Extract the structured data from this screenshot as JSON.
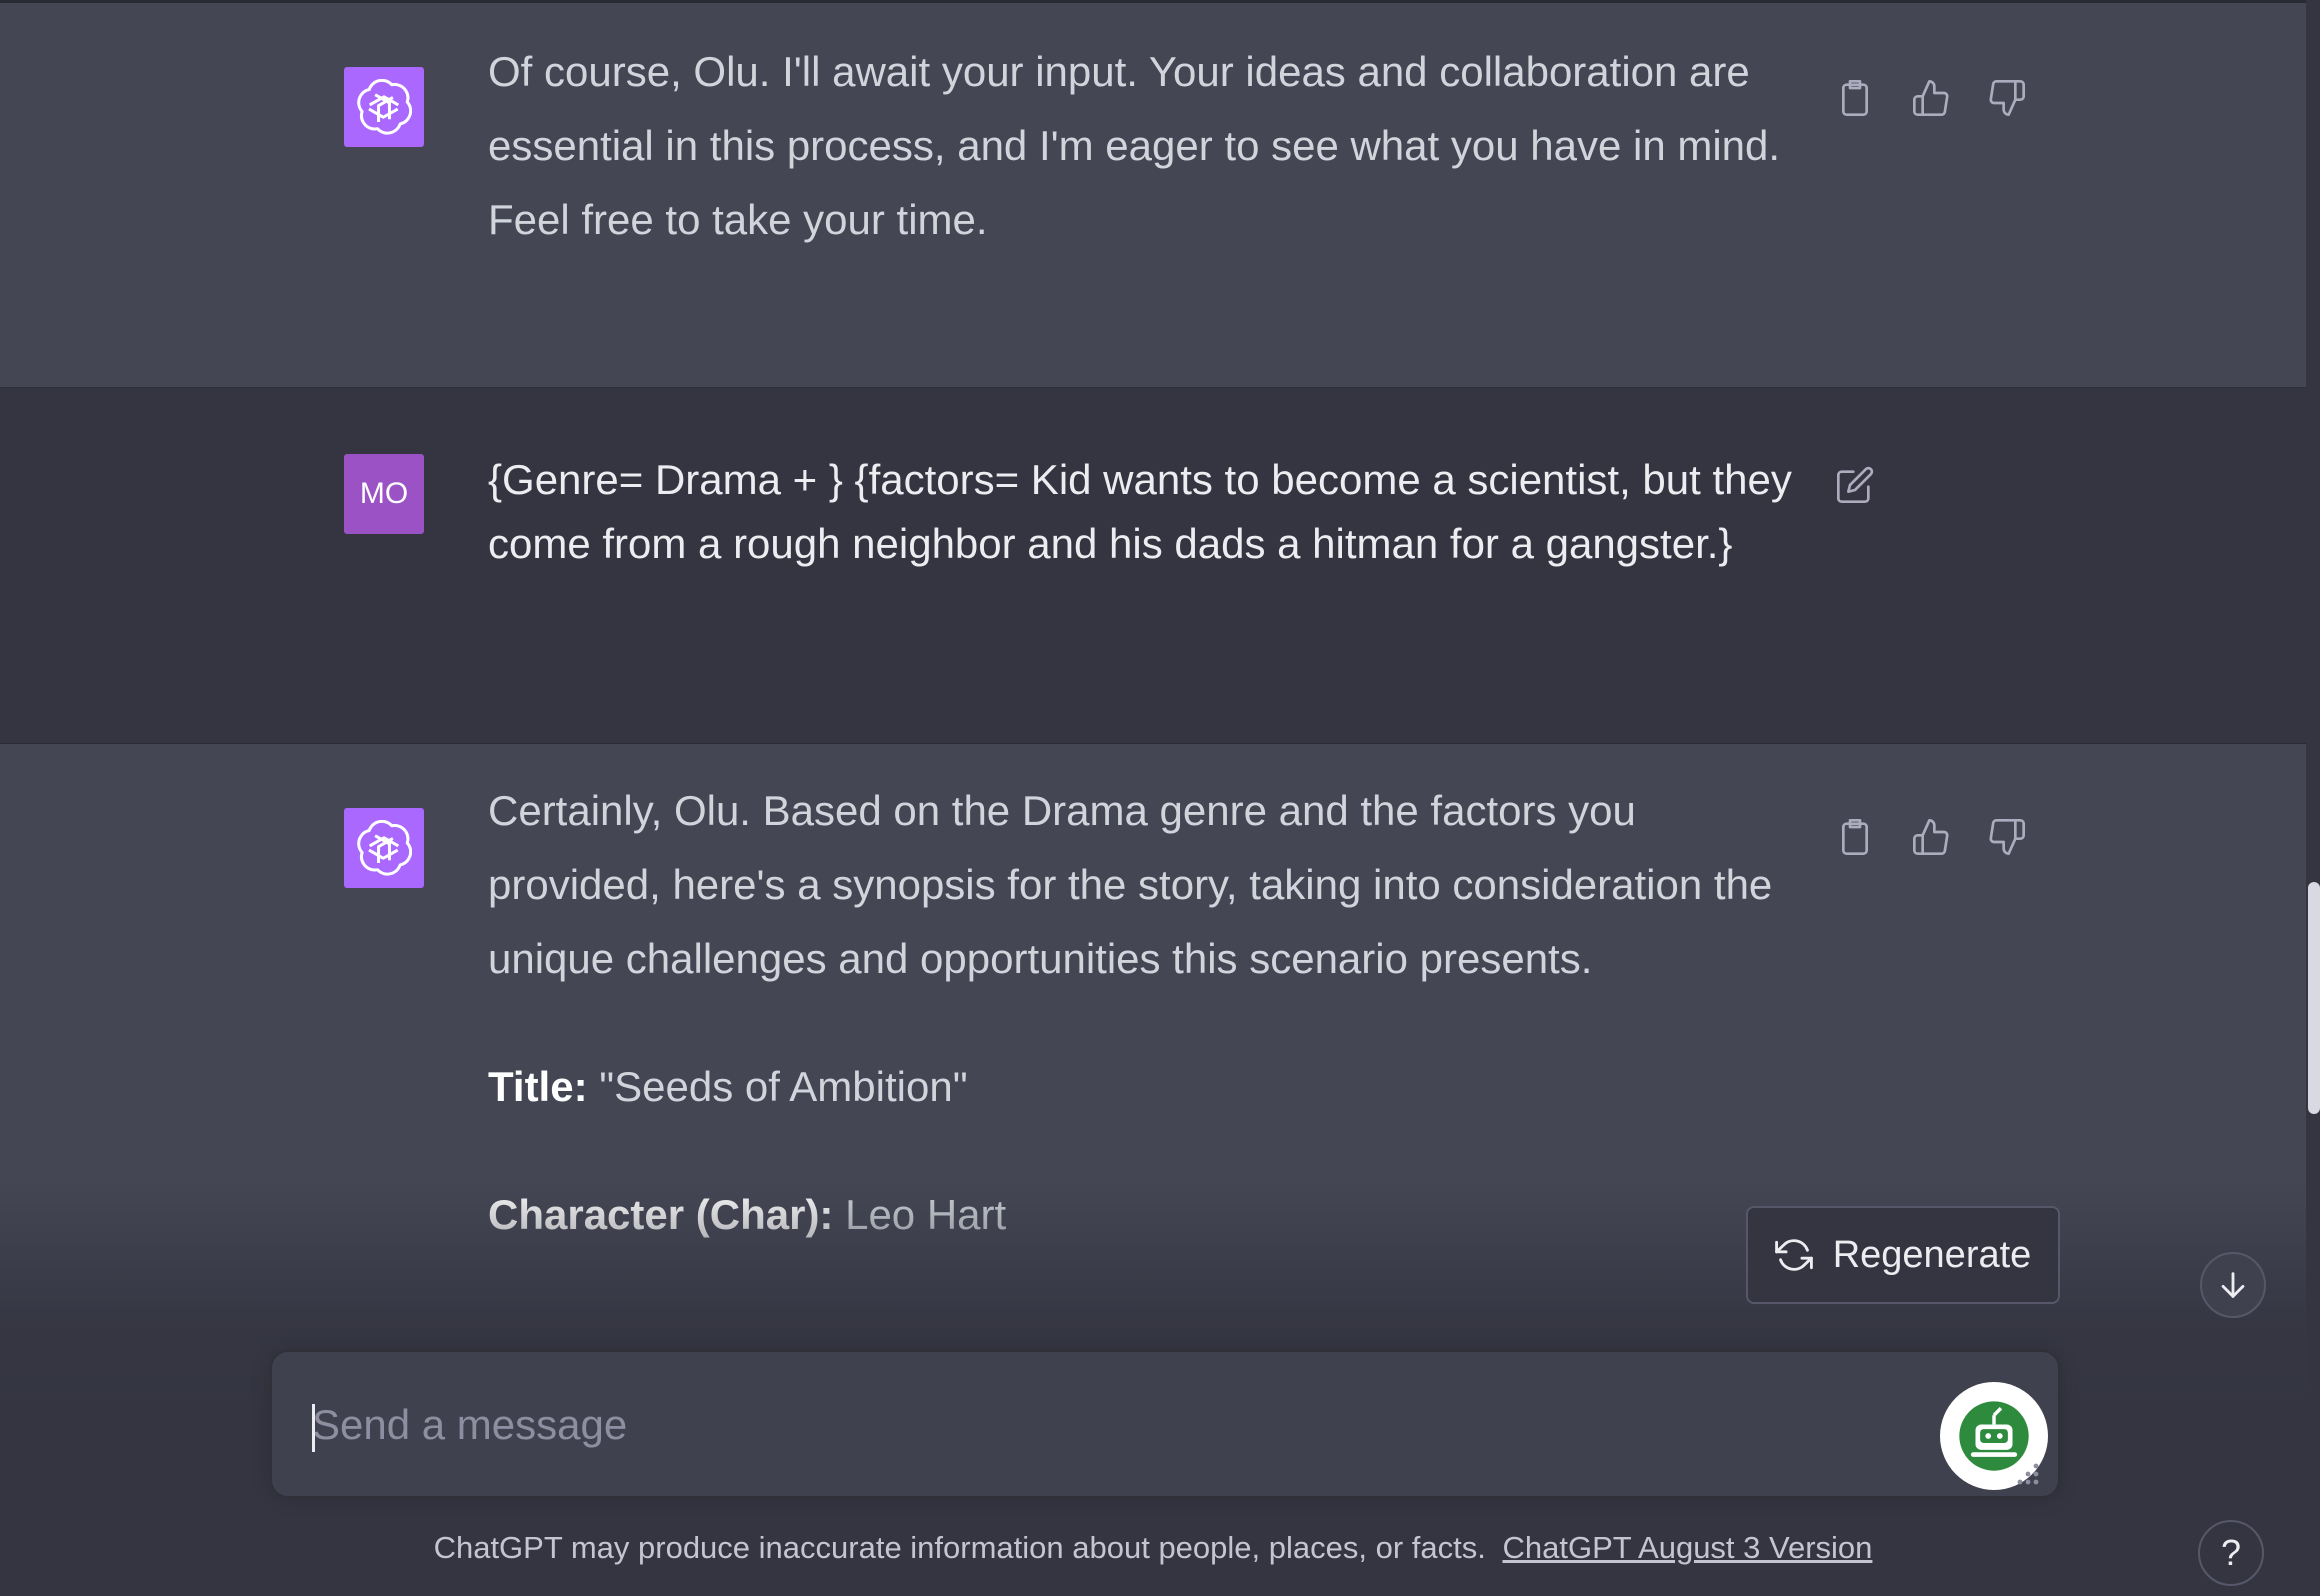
{
  "messages": [
    {
      "role": "assistant",
      "avatar_icon": "openai-logo-icon",
      "text": "Of course, Olu. I'll await your input. Your ideas and collaboration are essential in this process, and I'm eager to see what you have in mind. Feel free to take your time."
    },
    {
      "role": "user",
      "avatar_initials": "MO",
      "text": "{Genre= Drama + } {factors= Kid wants to become a scientist, but they come from a rough neighbor and his dads a hitman for a gangster.}"
    },
    {
      "role": "assistant",
      "avatar_icon": "openai-logo-icon",
      "intro": "Certainly, Olu. Based on the Drama genre and the factors you provided, here's a synopsis for the story, taking into consideration the unique challenges and opportunities this scenario presents.",
      "title_label": "Title:",
      "title_value": "\"Seeds of Ambition\"",
      "character_label": "Character (Char):",
      "character_value": "Leo Hart"
    }
  ],
  "actions": {
    "copy_icon": "clipboard-icon",
    "like_icon": "thumbs-up-icon",
    "dislike_icon": "thumbs-down-icon",
    "edit_icon": "edit-icon"
  },
  "regenerate": {
    "label": "Regenerate",
    "icon": "refresh-icon"
  },
  "composer": {
    "placeholder": "Send a message",
    "value": ""
  },
  "footer": {
    "disclaimer": "ChatGPT may produce inaccurate information about people, places, or facts.",
    "version_link": "ChatGPT August 3 Version"
  },
  "help": {
    "label": "?"
  },
  "colors": {
    "background": "#343541",
    "assistant_background": "#444654",
    "gpt_avatar": "#ab68ff",
    "user_avatar": "#9a52c4"
  }
}
